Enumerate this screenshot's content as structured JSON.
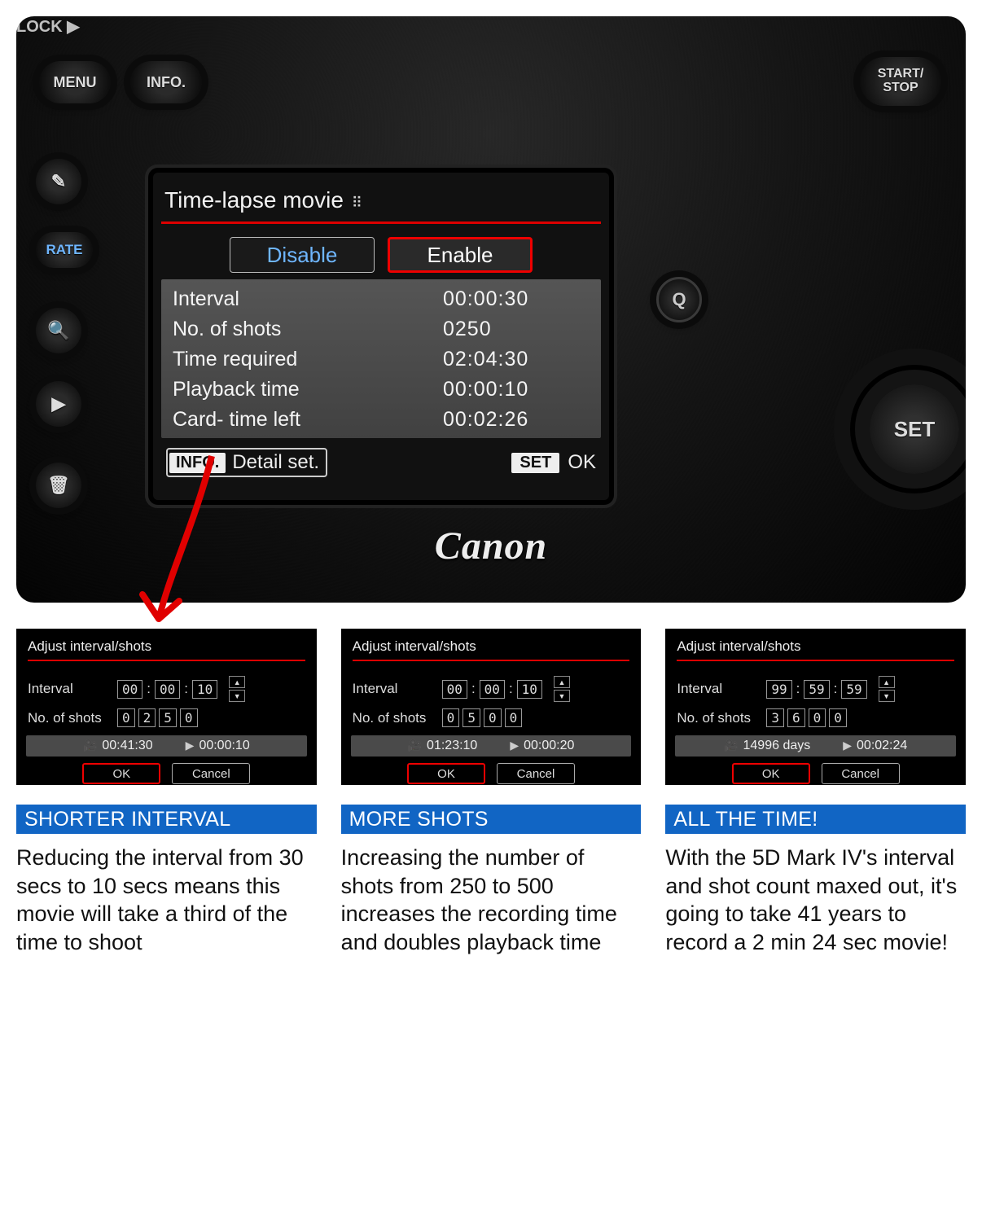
{
  "camera": {
    "brand_logo": "Canon",
    "buttons": {
      "menu": "MENU",
      "info": "INFO.",
      "start_l1": "START/",
      "start_l2": "STOP",
      "rate": "RATE",
      "edit_icon": "✎",
      "magnify_icon": "🔍",
      "play_icon": "▶",
      "trash_icon": "🗑",
      "q_icon": "Q",
      "set": "SET",
      "lock": "LOCK ▶"
    }
  },
  "lcd": {
    "title": "Time-lapse movie",
    "title_icon": "⠿",
    "disable": "Disable",
    "enable": "Enable",
    "rows": {
      "interval_k": "Interval",
      "interval_v": "00:00:30",
      "shots_k": "No. of shots",
      "shots_v": "0250",
      "time_k": "Time required",
      "time_v": "02:04:30",
      "play_k": "Playback time",
      "play_v": "00:00:10",
      "card_k": "Card- time left",
      "card_v": "00:02:26"
    },
    "footer": {
      "info_tag": "INFO.",
      "info_label": "Detail set.",
      "set_tag": "SET",
      "set_label": "OK"
    }
  },
  "thumbs": [
    {
      "title": "Adjust interval/shots",
      "interval_label": "Interval",
      "interval": [
        "00",
        "00",
        "10"
      ],
      "shots_label": "No. of shots",
      "shots": [
        "0",
        "2",
        "5",
        "0"
      ],
      "rec": "00:41:30",
      "play": "00:00:10",
      "ok": "OK",
      "cancel": "Cancel",
      "chip": "SHORTER INTERVAL",
      "caption": "Reducing the interval from 30 secs to 10 secs means this movie will take a third of the time to shoot"
    },
    {
      "title": "Adjust interval/shots",
      "interval_label": "Interval",
      "interval": [
        "00",
        "00",
        "10"
      ],
      "shots_label": "No. of shots",
      "shots": [
        "0",
        "5",
        "0",
        "0"
      ],
      "rec": "01:23:10",
      "play": "00:00:20",
      "ok": "OK",
      "cancel": "Cancel",
      "chip": "MORE SHOTS",
      "caption": "Increasing the number of shots from 250 to 500 increases the recording time and doubles playback time"
    },
    {
      "title": "Adjust interval/shots",
      "interval_label": "Interval",
      "interval": [
        "99",
        "59",
        "59"
      ],
      "shots_label": "No. of shots",
      "shots": [
        "3",
        "6",
        "0",
        "0"
      ],
      "rec": "14996 days",
      "play": "00:02:24",
      "ok": "OK",
      "cancel": "Cancel",
      "chip": "ALL THE TIME!",
      "caption": "With the 5D Mark IV's interval and shot count maxed out, it's going to take 41 years to record a 2 min 24 sec movie!"
    }
  ],
  "icons": {
    "rec": "🎥",
    "play": "▶",
    "up": "▲",
    "down": "▼"
  }
}
